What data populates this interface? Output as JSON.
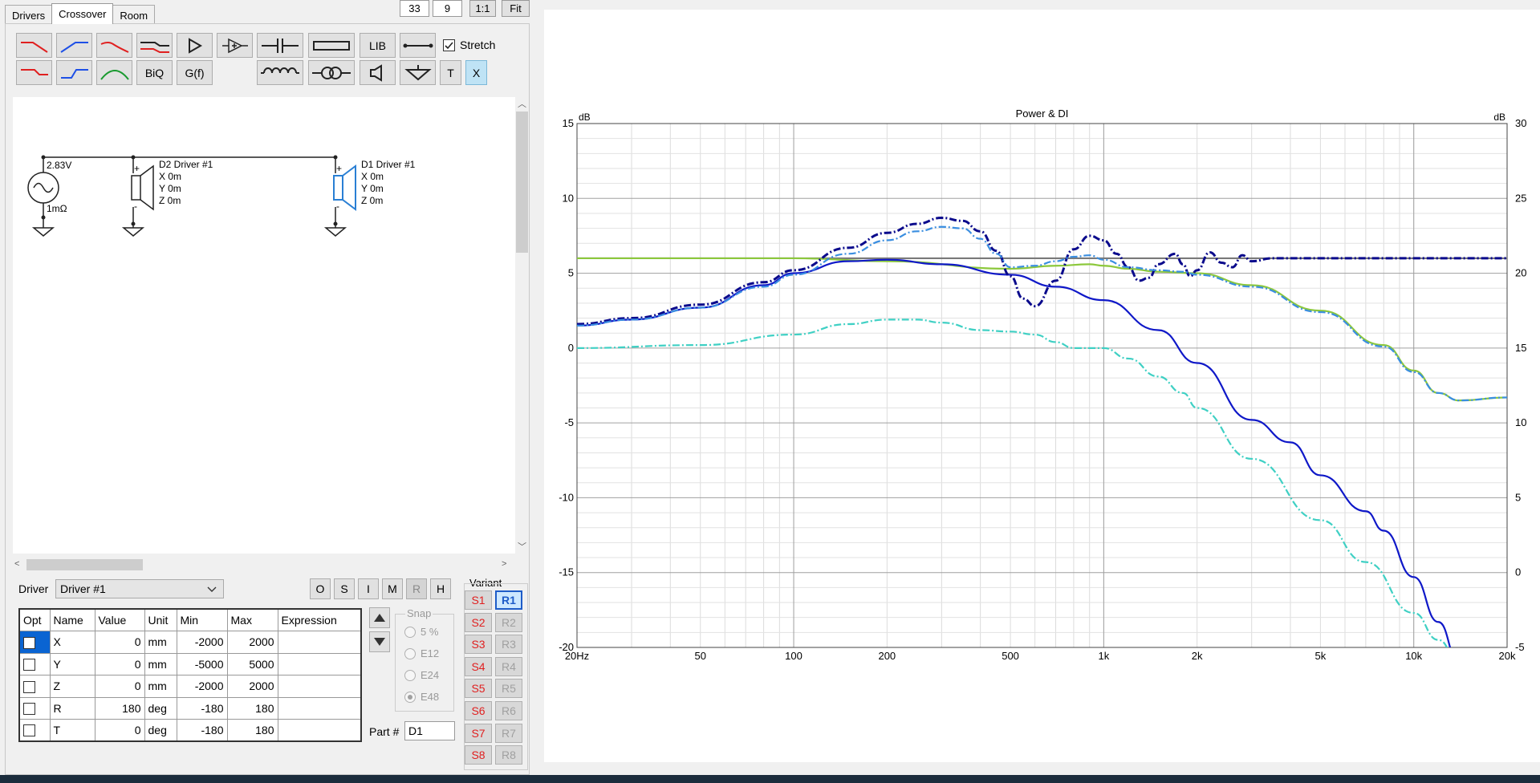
{
  "tabs": [
    "Drivers",
    "Crossover",
    "Room"
  ],
  "top_controls": {
    "zoom_a": "33",
    "zoom_b": "9",
    "one_to_one": "1:1",
    "fit": "Fit"
  },
  "toolbar": {
    "lib": "LIB",
    "biq": "BiQ",
    "gf": "G(f)",
    "t": "T",
    "x": "X",
    "stretch_label": "Stretch",
    "stretch_checked": true
  },
  "schematic": {
    "source_voltage": "2.83V",
    "source_impedance": "1mΩ",
    "d2": {
      "name": "D2 Driver #1",
      "x": "X 0m",
      "y": "Y 0m",
      "z": "Z 0m"
    },
    "d1": {
      "name": "D1 Driver #1",
      "x": "X 0m",
      "y": "Y 0m",
      "z": "Z 0m"
    }
  },
  "driver_select": {
    "label": "Driver",
    "value": "Driver #1"
  },
  "mode_buttons": [
    "O",
    "S",
    "I",
    "M",
    "R",
    "H"
  ],
  "table": {
    "headers": [
      "Opt",
      "Name",
      "Value",
      "Unit",
      "Min",
      "Max",
      "Expression"
    ],
    "rows": [
      {
        "name": "X",
        "value": "0",
        "unit": "mm",
        "min": "-2000",
        "max": "2000",
        "expr": ""
      },
      {
        "name": "Y",
        "value": "0",
        "unit": "mm",
        "min": "-5000",
        "max": "5000",
        "expr": ""
      },
      {
        "name": "Z",
        "value": "0",
        "unit": "mm",
        "min": "-2000",
        "max": "2000",
        "expr": ""
      },
      {
        "name": "R",
        "value": "180",
        "unit": "deg",
        "min": "-180",
        "max": "180",
        "expr": ""
      },
      {
        "name": "T",
        "value": "0",
        "unit": "deg",
        "min": "-180",
        "max": "180",
        "expr": ""
      }
    ]
  },
  "snap": {
    "title": "Snap",
    "options": [
      "5 %",
      "E12",
      "E24",
      "E48"
    ],
    "selected": "E48"
  },
  "part": {
    "label": "Part #",
    "value": "D1"
  },
  "variant": {
    "title": "Variant",
    "s": [
      "S1",
      "S2",
      "S3",
      "S4",
      "S5",
      "S6",
      "S7",
      "S8"
    ],
    "r": [
      "R1",
      "R2",
      "R3",
      "R4",
      "R5",
      "R6",
      "R7",
      "R8"
    ],
    "selected_r": "R1"
  },
  "chart_data": {
    "type": "line",
    "title": "Power & DI",
    "xlabel": "",
    "ylabel_left": "dB",
    "ylabel_right": "dB",
    "x_scale": "log",
    "xlim": [
      20,
      20000
    ],
    "ylim_left": [
      -20,
      15
    ],
    "ylim_right": [
      -5,
      30
    ],
    "x_ticks": [
      {
        "v": 20,
        "label": "20Hz"
      },
      {
        "v": 50,
        "label": "50"
      },
      {
        "v": 100,
        "label": "100"
      },
      {
        "v": 200,
        "label": "200"
      },
      {
        "v": 500,
        "label": "500"
      },
      {
        "v": 1000,
        "label": "1k"
      },
      {
        "v": 2000,
        "label": "2k"
      },
      {
        "v": 5000,
        "label": "5k"
      },
      {
        "v": 10000,
        "label": "10k"
      },
      {
        "v": 20000,
        "label": "20k"
      }
    ],
    "y_ticks_left": [
      "15",
      "10",
      "5",
      "0",
      "-5",
      "-10",
      "-15",
      "-20"
    ],
    "y_ticks_right": [
      "30",
      "25",
      "20",
      "15",
      "10",
      "5",
      "0",
      "-5"
    ],
    "grid": true,
    "series": [
      {
        "color": "#7a7a7a",
        "style": "solid",
        "x": [
          20,
          20000
        ],
        "y": [
          6,
          6
        ]
      },
      {
        "color": "#8cc83c",
        "style": "solid",
        "x": [
          20,
          100,
          200,
          500,
          700,
          900,
          1000,
          1200,
          1500,
          2000,
          3000,
          5000,
          8000,
          10000,
          12000,
          14000,
          20000
        ],
        "y": [
          6,
          6,
          5.8,
          5.3,
          5.5,
          5.6,
          5.5,
          5.3,
          5.1,
          5,
          4.2,
          2.5,
          0.2,
          -1.5,
          -3,
          -3.5,
          -3.3
        ]
      },
      {
        "color": "#0f18c8",
        "style": "solid",
        "x": [
          20,
          30,
          50,
          80,
          100,
          150,
          200,
          300,
          500,
          700,
          1000,
          1500,
          2000,
          3000,
          4000,
          5000,
          7000,
          8000,
          10000,
          12000,
          14000,
          20000
        ],
        "y": [
          1.5,
          1.9,
          2.7,
          4.2,
          5,
          5.8,
          5.9,
          5.6,
          4.9,
          4.1,
          3.2,
          1.2,
          -1,
          -4.8,
          -6.3,
          -8.5,
          -10.9,
          -12.2,
          -15.3,
          -18.3,
          -21,
          -27
        ]
      },
      {
        "color": "#0a0a8c",
        "style": "dashdot",
        "x": [
          20,
          30,
          50,
          80,
          100,
          150,
          200,
          250,
          300,
          350,
          400,
          450,
          500,
          550,
          600,
          700,
          800,
          900,
          1000,
          1100,
          1200,
          1300,
          1400,
          1500,
          1700,
          1800,
          1900,
          2000,
          2200,
          2400,
          2600,
          2800,
          3000,
          3500,
          5000,
          10000,
          20000
        ],
        "y": [
          1.6,
          2,
          2.9,
          4.4,
          5.2,
          6.7,
          7.7,
          8.3,
          8.7,
          8.5,
          7.8,
          6.5,
          4.8,
          3.3,
          2.8,
          4.5,
          6.6,
          7.5,
          7.2,
          6.3,
          5.4,
          4.5,
          4.7,
          5.6,
          6.3,
          5.6,
          4.8,
          5.2,
          6.4,
          5.7,
          5.4,
          6.2,
          5.8,
          6,
          6,
          6,
          6
        ]
      },
      {
        "color": "#3a8ee0",
        "style": "dashdot",
        "x": [
          20,
          30,
          50,
          80,
          100,
          150,
          200,
          250,
          300,
          350,
          400,
          450,
          500,
          600,
          700,
          800,
          900,
          1000,
          1200,
          1500,
          1800,
          2000,
          3000,
          5000,
          8000,
          10000,
          12000,
          14000,
          20000
        ],
        "y": [
          1.5,
          1.9,
          2.7,
          4.1,
          4.9,
          6.3,
          7.2,
          7.8,
          8.1,
          8,
          7.3,
          6.3,
          5.4,
          5.5,
          5.8,
          6.1,
          6.2,
          5.9,
          5.4,
          5.2,
          5.1,
          4.9,
          4.1,
          2.4,
          0.1,
          -1.6,
          -3,
          -3.5,
          -3.3
        ]
      },
      {
        "color": "#3fd0c4",
        "style": "dashdot",
        "x": [
          20,
          50,
          100,
          150,
          200,
          250,
          300,
          400,
          500,
          600,
          700,
          800,
          900,
          1000,
          1200,
          1500,
          1800,
          2000,
          3000,
          5000,
          7000,
          10000,
          12000,
          14000,
          20000
        ],
        "y": [
          0,
          0.2,
          0.9,
          1.6,
          1.9,
          1.9,
          1.7,
          1.2,
          1.1,
          0.9,
          0.4,
          0,
          0,
          0,
          -0.7,
          -1.9,
          -3,
          -4,
          -7.4,
          -11.5,
          -14.3,
          -17.7,
          -19.5,
          -21,
          -25
        ]
      }
    ]
  }
}
